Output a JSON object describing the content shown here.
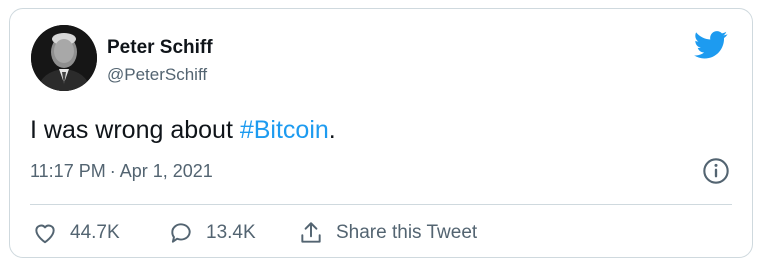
{
  "author": {
    "name": "Peter Schiff",
    "handle": "@PeterSchiff"
  },
  "tweet": {
    "text_before": "I was wrong about ",
    "hashtag": "#Bitcoin",
    "text_after": "."
  },
  "meta": {
    "time": "11:17 PM",
    "separator": "·",
    "date": "Apr 1, 2021"
  },
  "actions": {
    "likes": "44.7K",
    "replies": "13.4K",
    "share_label": "Share this Tweet"
  },
  "icons": {
    "brand": "twitter-bird-icon",
    "info": "info-icon",
    "like": "heart-icon",
    "reply": "comment-bubble-icon",
    "share": "share-upload-icon"
  },
  "colors": {
    "brand_blue": "#1d9bf0",
    "text_primary": "#0f1419",
    "text_secondary": "#536471",
    "border": "#cfd9de"
  }
}
